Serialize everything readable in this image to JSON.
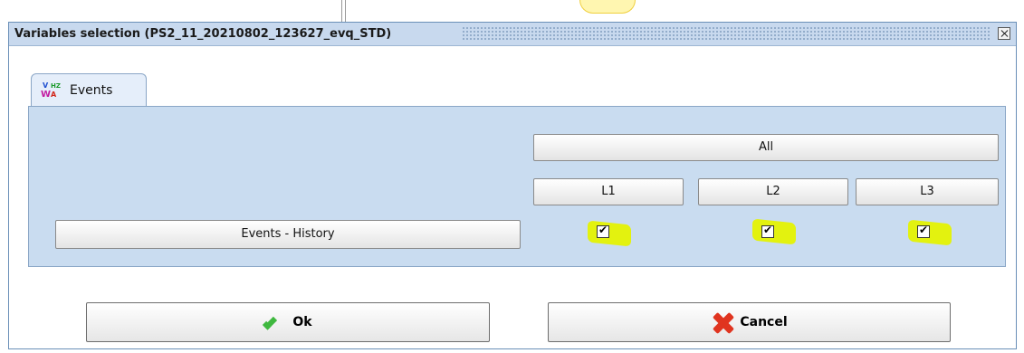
{
  "window": {
    "title": "Variables selection (PS2_11_20210802_123627_evq_STD)"
  },
  "tabs": [
    {
      "label": "Events",
      "icon": "vhzwa-icon"
    }
  ],
  "panel": {
    "all_label": "All",
    "history_label": "Events - History",
    "phases": [
      {
        "label": "L1",
        "checked": true
      },
      {
        "label": "L2",
        "checked": true
      },
      {
        "label": "L3",
        "checked": true
      }
    ]
  },
  "footer": {
    "ok_label": "Ok",
    "cancel_label": "Cancel"
  },
  "colors": {
    "panel_bg": "#c9dcf0",
    "highlight": "#e3f20f",
    "titlebar": "#c8d9ee"
  }
}
